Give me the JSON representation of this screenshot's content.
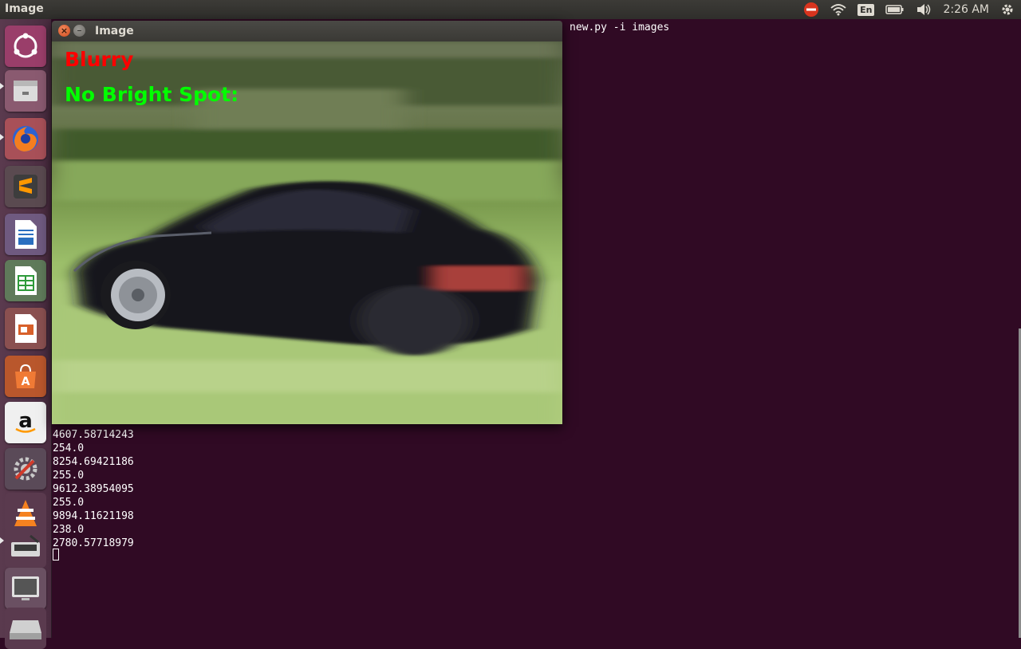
{
  "top_panel": {
    "title": "Image",
    "keyboard_layout": "En",
    "clock": "2:26 AM",
    "icons": [
      "do-not-disturb-icon",
      "wifi-icon",
      "keyboard-layout-icon",
      "battery-icon",
      "volume-icon",
      "settings-gear-icon"
    ]
  },
  "launcher": {
    "items": [
      "ubuntu-dash",
      "files",
      "firefox",
      "sublime-text",
      "libreoffice-writer",
      "libreoffice-calc",
      "libreoffice-impress",
      "ubuntu-software",
      "amazon",
      "system-settings",
      "vlc",
      "scanner",
      "display",
      "drive"
    ]
  },
  "terminal": {
    "command_line": "new.py -i images",
    "output": [
      "4607.58714243",
      "254.0",
      "8254.69421186",
      "255.0",
      "9612.38954095",
      "255.0",
      "9894.11621198",
      "238.0",
      "2780.57718979"
    ]
  },
  "image_window": {
    "title": "Image",
    "label_blurry": "Blurry",
    "label_spot": "No Bright Spot:"
  },
  "colors": {
    "terminal_bg": "#300a24",
    "blurry_text": "#ff0000",
    "spot_text": "#00ff00"
  }
}
